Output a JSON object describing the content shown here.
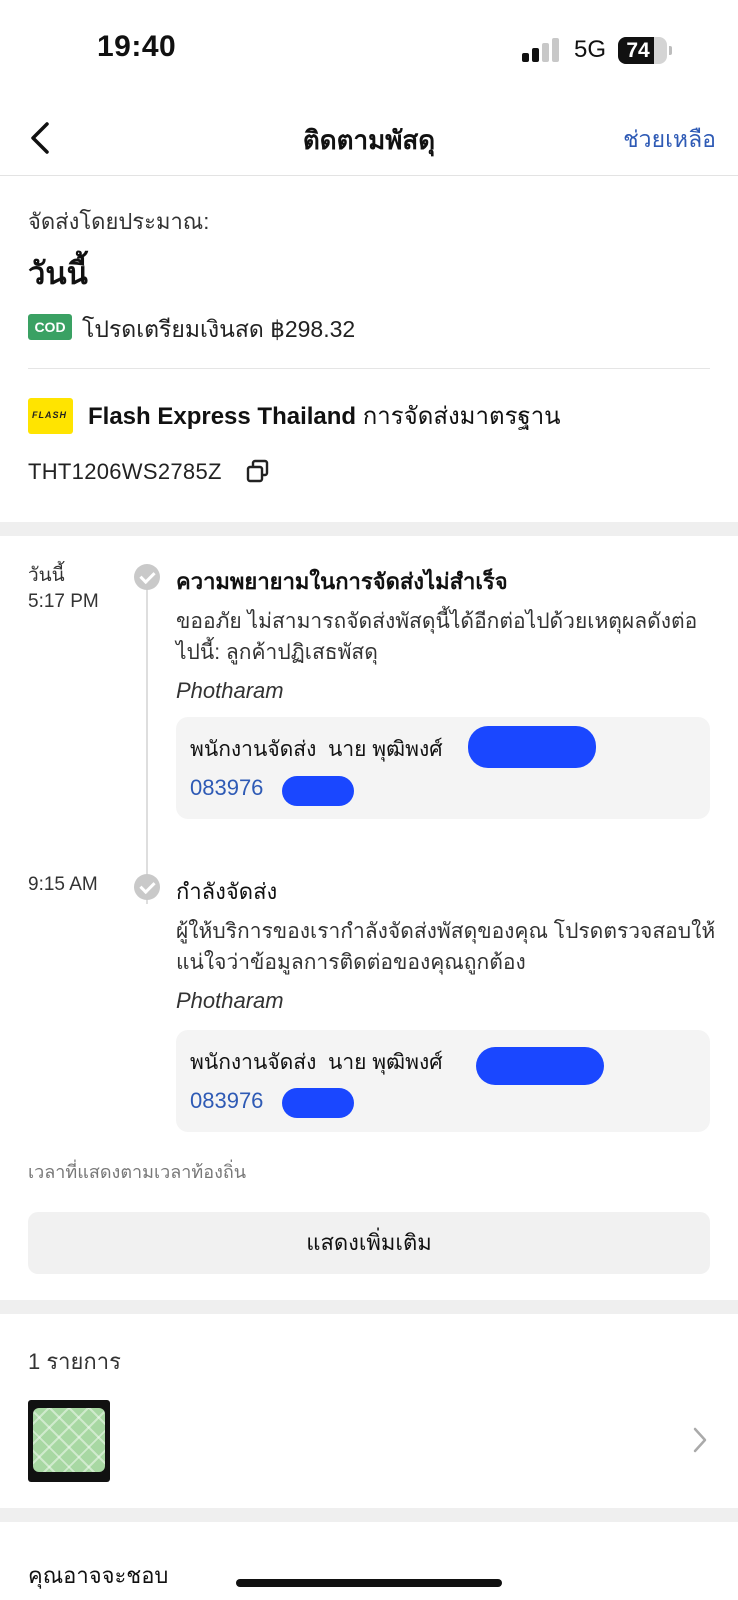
{
  "status_bar": {
    "time": "19:40",
    "network": "5G",
    "battery": "74",
    "battery_level": 0.74
  },
  "nav": {
    "title": "ติดตามพัสดุ",
    "help": "ช่วยเหลือ"
  },
  "summary": {
    "estimate_label": "จัดส่งโดยประมาณ:",
    "estimate_value": "วันนี้",
    "cod_badge": "COD",
    "cod_text": "โปรดเตรียมเงินสด ฿298.32",
    "carrier_logo_text": "FLASH",
    "carrier_name": "Flash Express Thailand",
    "carrier_service": "การจัดส่งมาตรฐาน",
    "tracking_number": "THT1206WS2785Z"
  },
  "timeline": [
    {
      "date": "วันนี้",
      "time": "5:17 PM",
      "title": "ความพยายามในการจัดส่งไม่สำเร็จ",
      "description": "ขออภัย ไม่สามารถจัดส่งพัสดุนี้ได้อีกต่อไปด้วยเหตุผลดังต่อไปนี้: ลูกค้าปฏิเสธพัสดุ",
      "location": "Photharam",
      "courier_label": "พนักงานจัดส่ง",
      "courier_name": "นาย พุฒิพงศ์",
      "courier_phone": "083976"
    },
    {
      "date": "",
      "time": "9:15 AM",
      "title": "กำลังจัดส่ง",
      "description": "ผู้ให้บริการของเรากำลังจัดส่งพัสดุของคุณ โปรดตรวจสอบให้แน่ใจว่าข้อมูลการติดต่อของคุณถูกต้อง",
      "location": "Photharam",
      "courier_label": "พนักงานจัดส่ง",
      "courier_name": "นาย พุฒิพงศ์",
      "courier_phone": "083976"
    }
  ],
  "time_note": "เวลาที่แสดงตามเวลาท้องถิ่น",
  "show_more": "แสดงเพิ่มเติม",
  "items": {
    "count_label": "1 รายการ"
  },
  "recommend": {
    "title": "คุณอาจจะชอบ"
  },
  "colors": {
    "accent_link": "#2e5ab5",
    "cod_green": "#3aa163",
    "redaction": "#1a47ff"
  },
  "icons": [
    "back-icon",
    "copy-icon",
    "check-icon",
    "chevron-right-icon"
  ]
}
